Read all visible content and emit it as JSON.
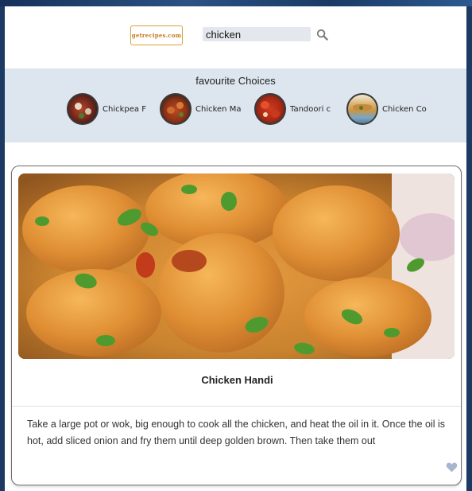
{
  "header": {
    "logo_text": "getrecipes.com",
    "search": {
      "value": "chicken",
      "icon": "search-icon"
    }
  },
  "favourites": {
    "title": "favourite Choices",
    "items": [
      {
        "label": "Chickpea F"
      },
      {
        "label": "Chicken Ma"
      },
      {
        "label": "Tandoori c"
      },
      {
        "label": "Chicken Co"
      }
    ]
  },
  "recipe": {
    "title": "Chicken Handi",
    "description": "Take a large pot or wok, big enough to cook all the chicken, and heat the oil in it. Once the oil is hot, add sliced onion and fry them until deep golden brown. Then take them out",
    "favorite_icon": "heart-icon"
  },
  "colors": {
    "favourites_band": "#dde6ef",
    "search_field": "#e4e8ee",
    "heart": "#a9b6cf",
    "logo": "#c87a1d"
  }
}
